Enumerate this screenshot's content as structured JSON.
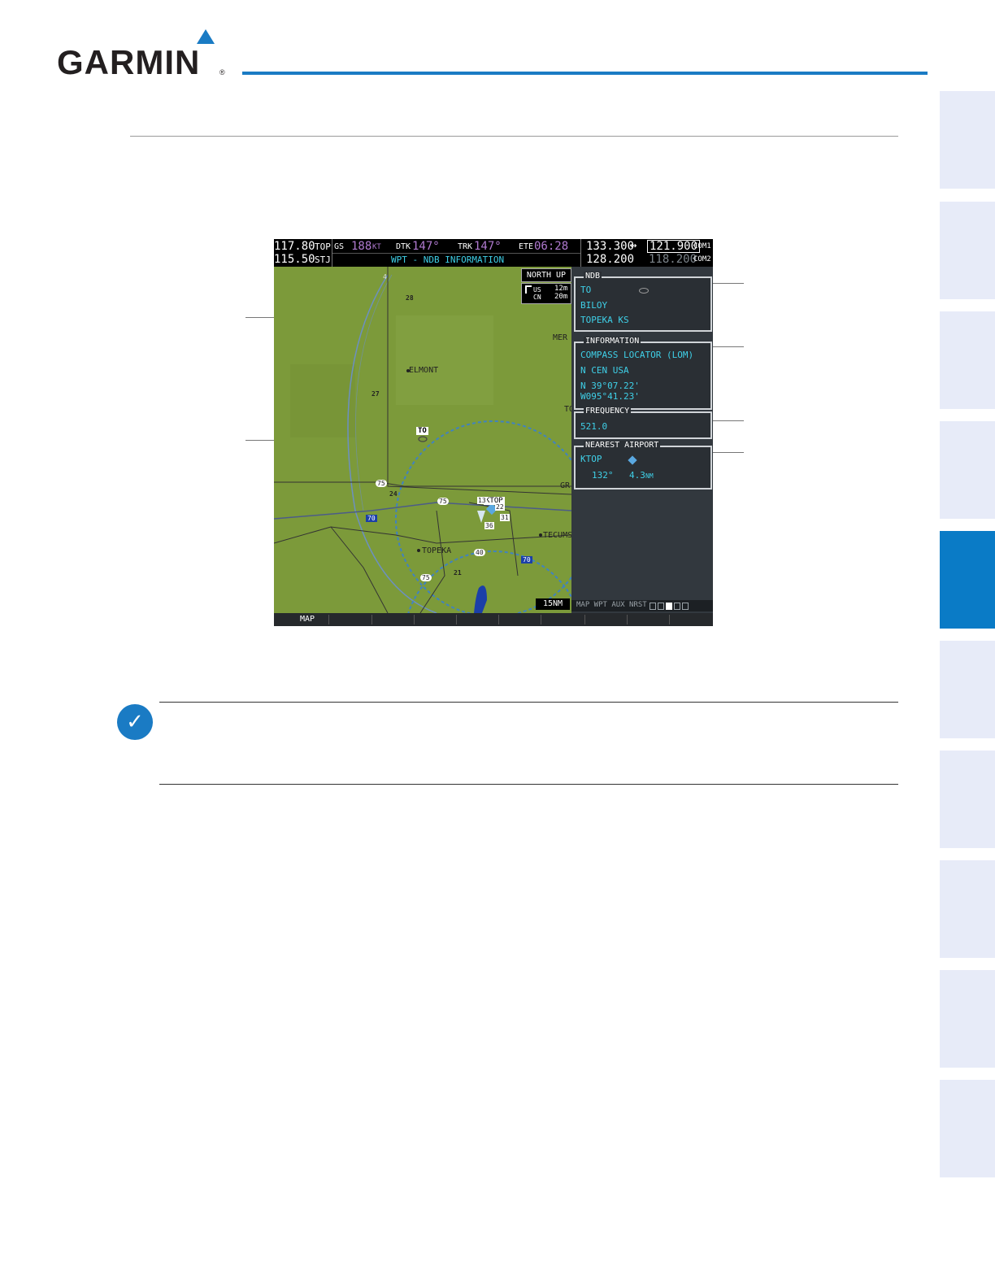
{
  "header": {
    "logo_text": "GARMIN",
    "registered_mark": "®"
  },
  "figure": {
    "top_bar": {
      "nav1_active": "117.80",
      "nav1_id": "TOP",
      "nav2_standby": "115.50",
      "nav2_id": "STJ",
      "gs_label": "GS",
      "gs_value": "188",
      "gs_unit": "KT",
      "dtk_label": "DTK",
      "dtk_value": "147°",
      "trk_label": "TRK",
      "trk_value": "147°",
      "ete_label": "ETE",
      "ete_value": "06:28",
      "page_title": "WPT - NDB INFORMATION",
      "com_active": "133.300",
      "com_arrow": "↔",
      "com_standby": "121.900",
      "com1_label": "COM1",
      "com2_active": "128.200",
      "com2_standby": "118.200",
      "com2_label": "COM2"
    },
    "map": {
      "orientation": "NORTH UP",
      "wind_labels": [
        "US",
        "CN"
      ],
      "wind_values": [
        "12m",
        "20m"
      ],
      "scale": "15NM",
      "places": [
        "ELMONT",
        "TOPEKA",
        "TECUMS",
        "MER",
        "TO",
        "GR"
      ],
      "ndb_label": "TO",
      "airport_label": "KTOP",
      "route_numbers": [
        "75",
        "70",
        "75",
        "70",
        "75",
        "40",
        "4"
      ],
      "runway_labels": [
        "13",
        "22",
        "31",
        "36"
      ],
      "sector_numbers": [
        "28",
        "27",
        "24",
        "21"
      ]
    },
    "panel": {
      "ndb_title": "NDB",
      "ndb_ident": "TO",
      "ndb_name": "BILOY",
      "ndb_city": "TOPEKA KS",
      "info_title": "INFORMATION",
      "info_type": "COMPASS LOCATOR (LOM)",
      "info_region": "N CEN USA",
      "info_lat": "N 39°07.22'",
      "info_lon": "W095°41.23'",
      "freq_title": "FREQUENCY",
      "freq_value": "521.0",
      "apt_title": "NEAREST AIRPORT",
      "apt_ident": "KTOP",
      "apt_bearing": "132°",
      "apt_dist": "4.3",
      "apt_unit": "NM",
      "page_group": "MAP WPT AUX NRST"
    },
    "softkeys": [
      "",
      "MAP",
      "",
      "",
      "",
      "",
      "",
      "",
      "",
      "",
      ""
    ]
  },
  "note": {
    "icon": "✓"
  }
}
